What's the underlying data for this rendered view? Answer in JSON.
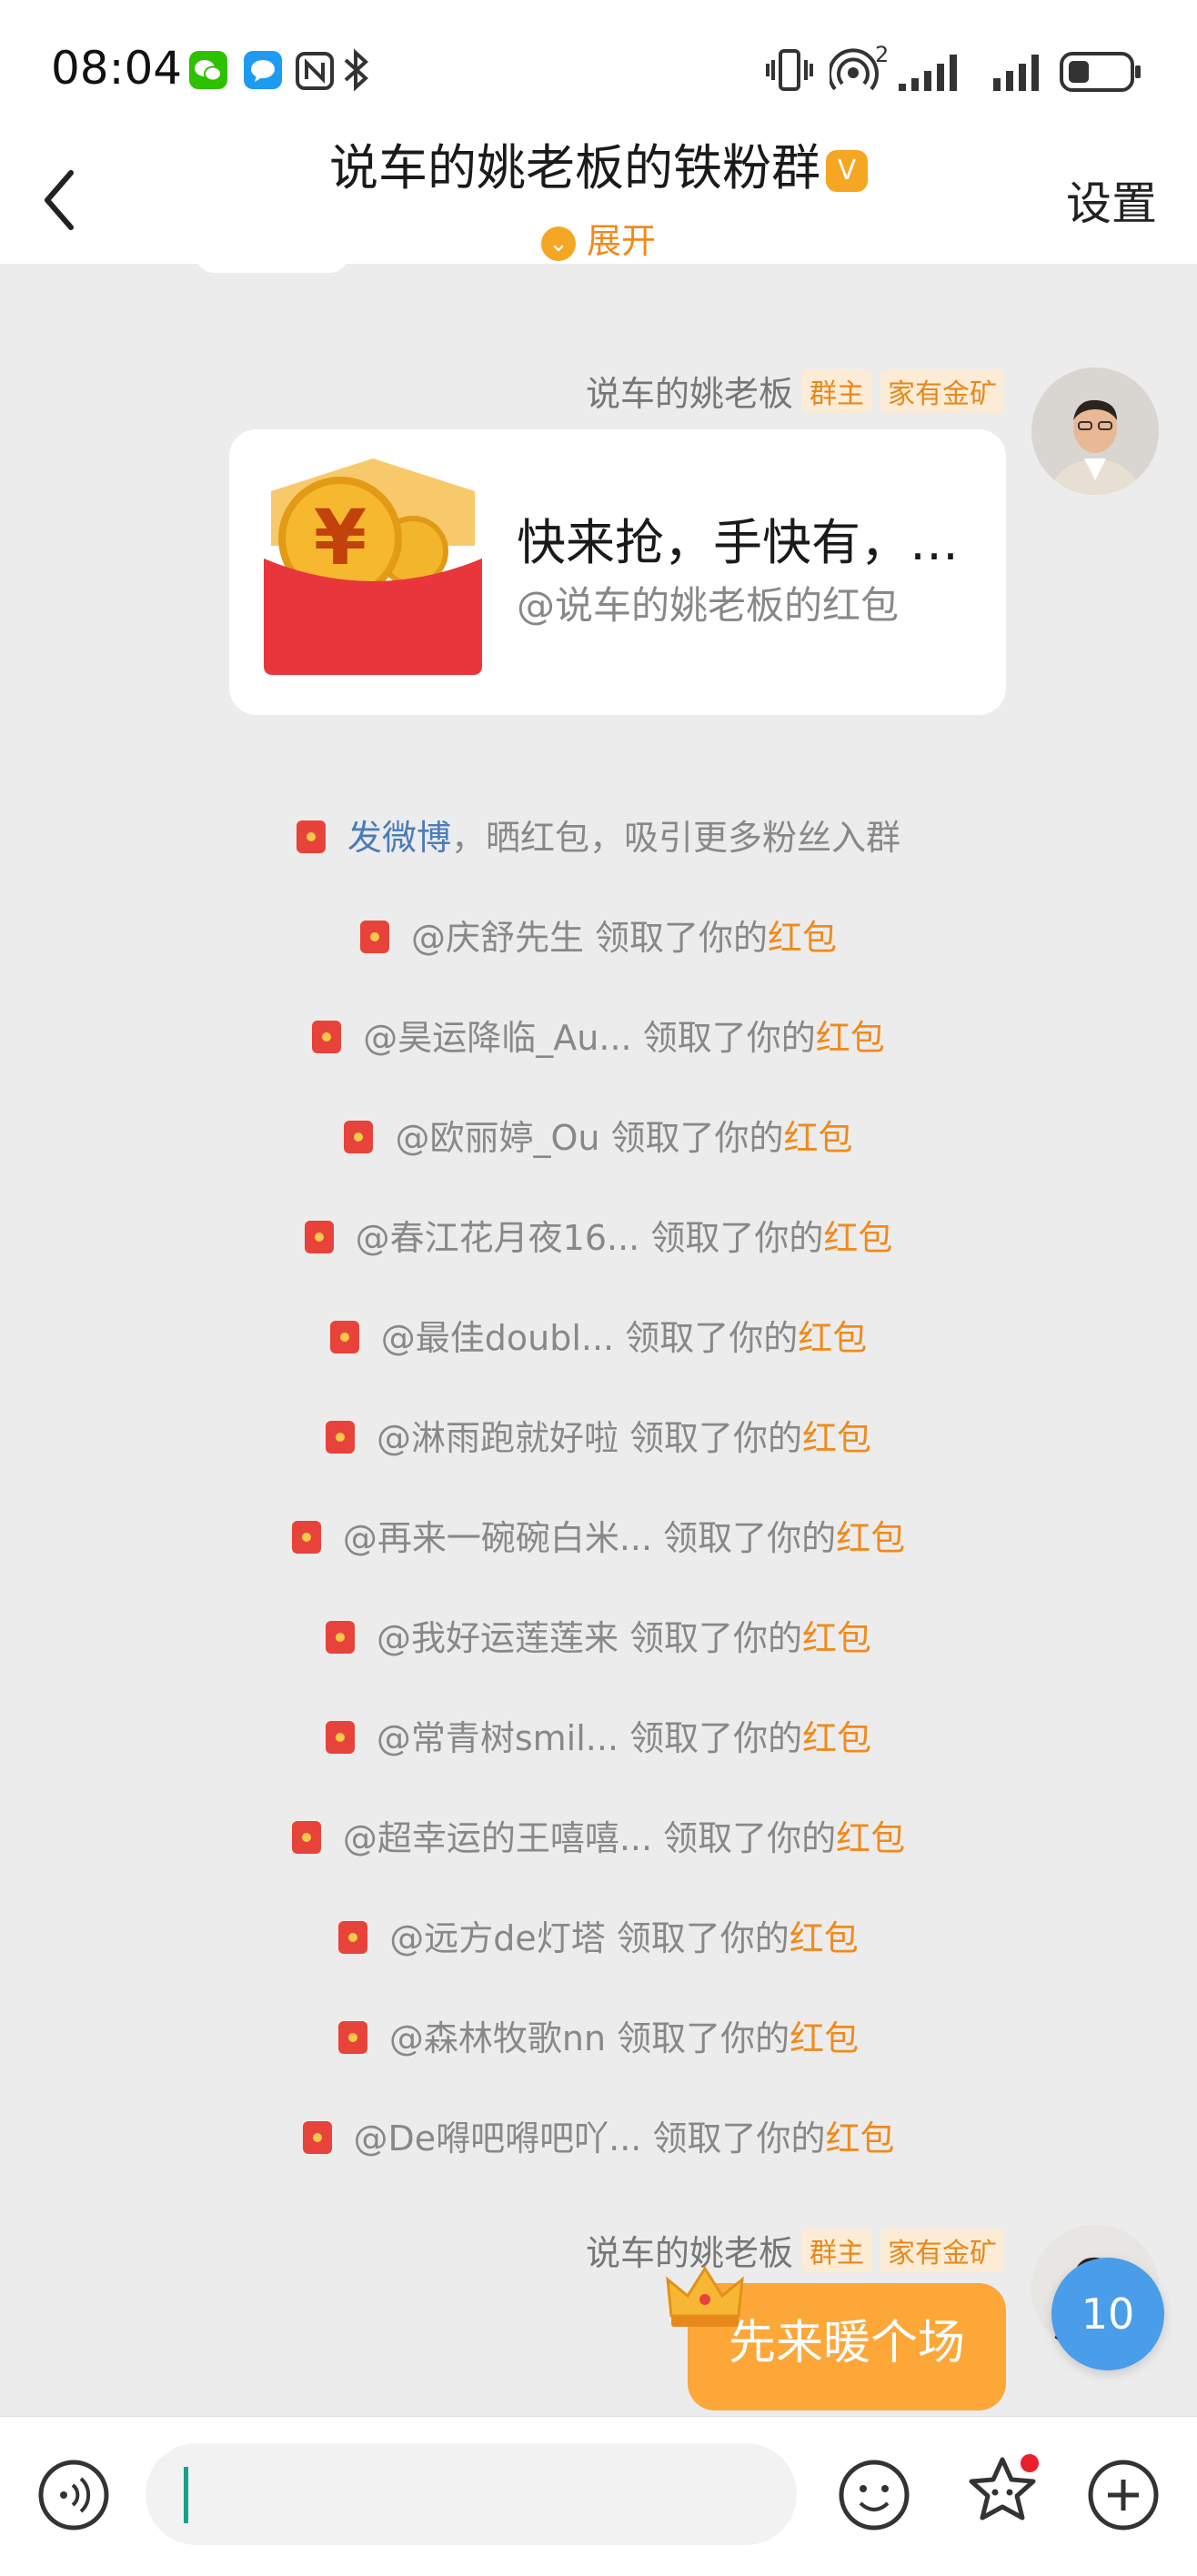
{
  "status_bar": {
    "time": "08:04",
    "signal_sup": "2",
    "icons": [
      "wechat-icon",
      "message-icon",
      "nfc-icon",
      "bluetooth-icon",
      "vibrate-icon",
      "hotspot-icon",
      "signal-icon",
      "signal-icon",
      "battery-icon"
    ]
  },
  "header": {
    "title": "说车的姚老板的铁粉群",
    "title_badge": "V",
    "expand_label": "展开",
    "settings_label": "设置"
  },
  "messages": [
    {
      "sender": "说车的姚老板",
      "tags": [
        "群主",
        "家有金矿"
      ],
      "red_packet": {
        "title": "快来抢，手快有，…",
        "subtitle": "@说车的姚老板的红包",
        "coin_symbol": "¥"
      }
    }
  ],
  "system_lines": [
    {
      "link": "发微博",
      "text": "，晒红包，吸引更多粉丝入群"
    },
    {
      "user": "@庆舒先生",
      "text": " 领取了你的",
      "highlight": "红包"
    },
    {
      "user": "@昊运降临_Au...",
      "text": " 领取了你的",
      "highlight": "红包"
    },
    {
      "user": "@欧丽婷_Ou",
      "text": " 领取了你的",
      "highlight": "红包"
    },
    {
      "user": "@春江花月夜16...",
      "text": " 领取了你的",
      "highlight": "红包"
    },
    {
      "user": "@最佳doubl...",
      "text": " 领取了你的",
      "highlight": "红包"
    },
    {
      "user": "@淋雨跑就好啦",
      "text": " 领取了你的",
      "highlight": "红包"
    },
    {
      "user": "@再来一碗碗白米...",
      "text": " 领取了你的",
      "highlight": "红包"
    },
    {
      "user": "@我好运莲莲来",
      "text": " 领取了你的",
      "highlight": "红包"
    },
    {
      "user": "@常青树smil...",
      "text": " 领取了你的",
      "highlight": "红包"
    },
    {
      "user": "@超幸运的王嘻嘻...",
      "text": " 领取了你的",
      "highlight": "红包"
    },
    {
      "user": "@远方de灯塔",
      "text": " 领取了你的",
      "highlight": "红包"
    },
    {
      "user": "@森林牧歌nn",
      "text": " 领取了你的",
      "highlight": "红包"
    },
    {
      "user": "@De嘚吧嘚吧吖...",
      "text": " 领取了你的",
      "highlight": "红包"
    }
  ],
  "last_message": {
    "sender": "说车的姚老板",
    "tags": [
      "群主",
      "家有金矿"
    ],
    "text": "先来暖个场"
  },
  "unread_count": "10",
  "input": {
    "value": "",
    "icons": [
      "voice-icon",
      "emoji-icon",
      "sticker-icon",
      "add-icon"
    ]
  },
  "colors": {
    "accent": "#f08a1c",
    "link": "#4a7cb8",
    "red_packet": "#e8433a",
    "unread_badge": "#4a9de8",
    "caret": "#18a08a"
  }
}
